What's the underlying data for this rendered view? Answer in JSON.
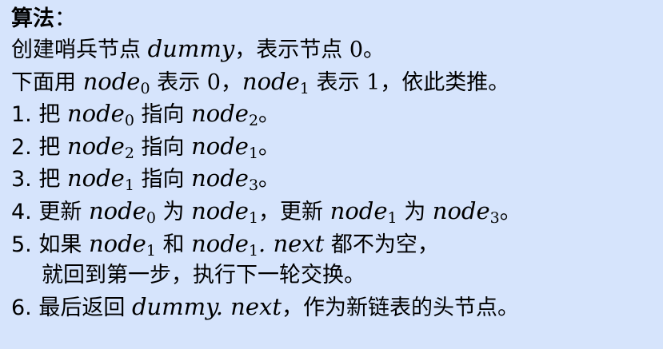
{
  "heading": {
    "title": "算法",
    "colon": "："
  },
  "line1": {
    "t1": "创建哨兵节点 ",
    "m1": "dummy",
    "t2": "，表示节点 ",
    "n1": "0",
    "t3": "。"
  },
  "line2": {
    "t1": "下面用 ",
    "m1": "node",
    "s1": "0",
    "t2": " 表示 ",
    "n1": "0",
    "t3": "，",
    "m2": "node",
    "s2": "1",
    "t4": " 表示 ",
    "n2": "1",
    "t5": "，依此类推。"
  },
  "steps": {
    "s1": {
      "num": "1.",
      "t1": " 把 ",
      "m1": "node",
      "s1": "0",
      "t2": " 指向 ",
      "m2": "node",
      "s2": "2",
      "t3": "。"
    },
    "s2": {
      "num": "2.",
      "t1": " 把 ",
      "m1": "node",
      "s1": "2",
      "t2": " 指向 ",
      "m2": "node",
      "s2": "1",
      "t3": "。"
    },
    "s3": {
      "num": "3.",
      "t1": " 把 ",
      "m1": "node",
      "s1": "1",
      "t2": " 指向 ",
      "m2": "node",
      "s2": "3",
      "t3": "。"
    },
    "s4": {
      "num": "4.",
      "t1": " 更新 ",
      "m1": "node",
      "s1": "0",
      "t2": " 为 ",
      "m2": "node",
      "s2": "1",
      "t3": "，更新 ",
      "m3": "node",
      "s3": "1",
      "t4": " 为 ",
      "m4": "node",
      "s4": "3",
      "t5": "。"
    },
    "s5": {
      "num": "5.",
      "t1": " 如果 ",
      "m1": "node",
      "s1": "1",
      "t2": " 和 ",
      "m2": "node",
      "s2": "1",
      "m3": ". next",
      "t3": " 都不为空，",
      "cont": "就回到第一步，执行下一轮交换。"
    },
    "s6": {
      "num": "6.",
      "t1": " 最后返回 ",
      "m1": "dummy. next",
      "t2": "，作为新链表的头节点。"
    }
  }
}
